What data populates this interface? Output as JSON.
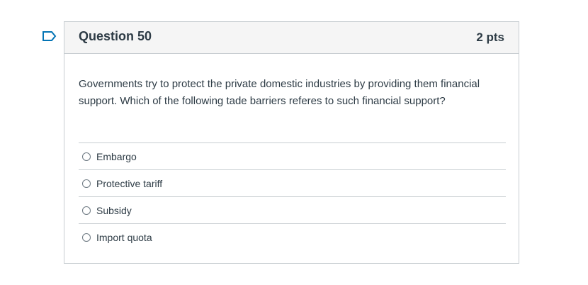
{
  "question": {
    "title": "Question 50",
    "points": "2 pts",
    "text": "Governments try to protect the private domestic industries by providing them financial support. Which of the following tade barriers referes to such financial support?",
    "flag_icon": "bookmark-flag-icon",
    "accent_color": "#0374b5"
  },
  "answers": [
    {
      "label": "Embargo"
    },
    {
      "label": "Protective tariff"
    },
    {
      "label": "Subsidy"
    },
    {
      "label": "Import quota"
    }
  ]
}
